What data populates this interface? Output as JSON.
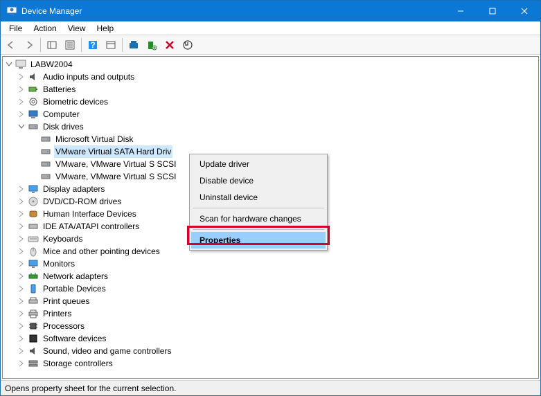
{
  "titlebar": {
    "title": "Device Manager"
  },
  "menubar": {
    "file": "File",
    "action": "Action",
    "view": "View",
    "help": "Help"
  },
  "tree": {
    "root": "LABW2004",
    "audio": "Audio inputs and outputs",
    "batteries": "Batteries",
    "biometric": "Biometric devices",
    "computer": "Computer",
    "disk": "Disk drives",
    "disk_children": {
      "d0": "Microsoft Virtual Disk",
      "d1": "VMware Virtual SATA Hard Driv",
      "d2": "VMware, VMware Virtual S SCSI",
      "d3": "VMware, VMware Virtual S SCSI"
    },
    "display": "Display adapters",
    "dvd": "DVD/CD-ROM drives",
    "hid": "Human Interface Devices",
    "ide": "IDE ATA/ATAPI controllers",
    "kbd": "Keyboards",
    "mouse": "Mice and other pointing devices",
    "monitors": "Monitors",
    "net": "Network adapters",
    "portable": "Portable Devices",
    "print": "Print queues",
    "printers": "Printers",
    "cpu": "Processors",
    "sw": "Software devices",
    "sound": "Sound, video and game controllers",
    "storage": "Storage controllers"
  },
  "ctx": {
    "update": "Update driver",
    "disable": "Disable device",
    "uninstall": "Uninstall device",
    "scan": "Scan for hardware changes",
    "properties": "Properties"
  },
  "status": "Opens property sheet for the current selection."
}
